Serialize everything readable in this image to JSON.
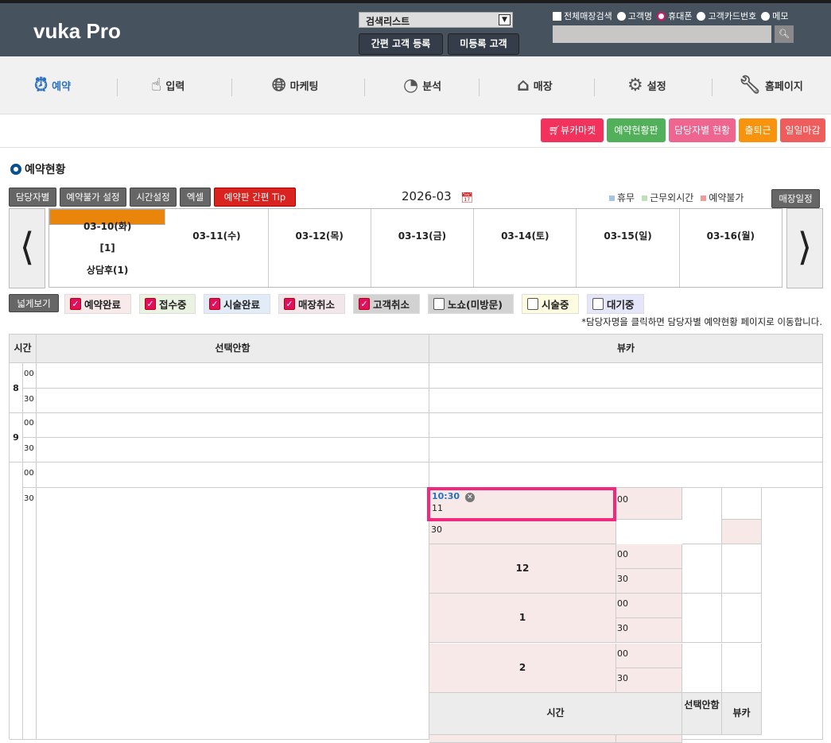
{
  "header": {
    "logo": "vuka Pro",
    "search_list": "검색리스트",
    "quick_register": "간편 고객 등록",
    "unregistered": "미등록 고객",
    "all_store_search": "전체매장검색",
    "radio_options": [
      "고객명",
      "휴대폰",
      "고객카드번호",
      "메모"
    ],
    "selected_radio": "휴대폰",
    "search_value": ""
  },
  "nav": {
    "items": [
      {
        "label": "예약",
        "icon": "alarm-clock-icon",
        "active": true
      },
      {
        "label": "입력",
        "icon": "hand-pointer-icon"
      },
      {
        "label": "마케팅",
        "icon": "globe-icon"
      },
      {
        "label": "분석",
        "icon": "pie-chart-icon"
      },
      {
        "label": "매장",
        "icon": "house-icon"
      },
      {
        "label": "설정",
        "icon": "gear-icon"
      },
      {
        "label": "홈페이지",
        "icon": "wrench-window-icon"
      }
    ]
  },
  "quick_buttons": [
    {
      "label": "뷰카마켓",
      "color": "#f0325c"
    },
    {
      "label": "예약현황판",
      "color": "#52b05a"
    },
    {
      "label": "담당자별 현황",
      "color": "#ee6590"
    },
    {
      "label": "출퇴근",
      "color": "#f7930c"
    },
    {
      "label": "일일마감",
      "color": "#ee5c5c"
    }
  ],
  "page_title": "예약현황",
  "toolbar": {
    "buttons": [
      "담당자별",
      "예약불가 설정",
      "시간설정",
      "엑셀",
      "예약판 간편 Tip"
    ],
    "month": "2026-03",
    "store_schedule": "매장일정",
    "legend": [
      {
        "label": "휴무",
        "color": "#a9c4e0"
      },
      {
        "label": "근무외시간",
        "color": "#bfe0b8"
      },
      {
        "label": "예약불가",
        "color": "#f29a9a"
      }
    ]
  },
  "days": [
    {
      "label": "03-10(화)",
      "count": "[1]",
      "sub": "상담후(1)",
      "selected": true
    },
    {
      "label": "03-11(수)"
    },
    {
      "label": "03-12(목)"
    },
    {
      "label": "03-13(금)"
    },
    {
      "label": "03-14(토)"
    },
    {
      "label": "03-15(일)"
    },
    {
      "label": "03-16(월)"
    }
  ],
  "filters": {
    "wide_view": "넓게보기",
    "items": [
      {
        "label": "예약완료",
        "checked": true,
        "bg": "#f8eaea"
      },
      {
        "label": "접수중",
        "checked": true,
        "bg": "#eaf3e2"
      },
      {
        "label": "시술완료",
        "checked": true,
        "bg": "#e2ecf8"
      },
      {
        "label": "매장취소",
        "checked": true,
        "bg": "#f3e6ea"
      },
      {
        "label": "고객취소",
        "checked": true,
        "bg": "#d2d2d2"
      },
      {
        "label": "노쇼(미방문)",
        "checked": false,
        "bg": "#d2d2d2"
      },
      {
        "label": "시술중",
        "checked": false,
        "bg": "#fdfbe0"
      },
      {
        "label": "대기중",
        "checked": false,
        "bg": "#e6e6fa"
      }
    ]
  },
  "note": "*담당자명을 클릭하면 담당자별 예약현황 페이지로 이동합니다.",
  "table": {
    "headers": [
      "시간",
      "선택안함",
      "뷰카"
    ],
    "hours": [
      "8",
      "9"
    ],
    "min00": "00",
    "min30": "30",
    "event": {
      "time": "10:30",
      "label": "11"
    },
    "nested_hours": [
      "12",
      "1",
      "2"
    ],
    "nested_header": [
      "시간",
      "선택안함",
      "뷰카"
    ]
  }
}
